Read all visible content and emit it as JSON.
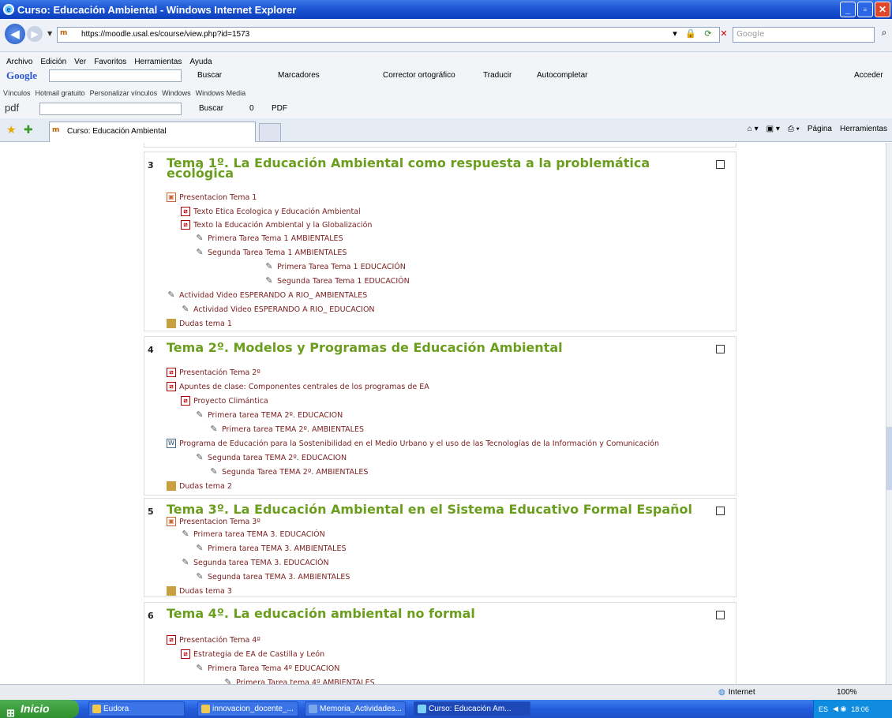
{
  "window": {
    "title": "Curso: Educación Ambiental - Windows Internet Explorer"
  },
  "address": {
    "url": "https://moodle.usal.es/course/view.php?id=1573",
    "search_placeholder": "Google"
  },
  "menu": [
    "Archivo",
    "Edición",
    "Ver",
    "Favoritos",
    "Herramientas",
    "Ayuda"
  ],
  "googlebar": {
    "logo": "Google",
    "buscar": "Buscar",
    "marcadores": "Marcadores",
    "corrector": "Corrector ortográfico",
    "traducir": "Traducir",
    "autocompletar": "Autocompletar",
    "acceder": "Acceder"
  },
  "links": {
    "label": "Vínculos",
    "items": [
      "Hotmail gratuito",
      "Personalizar vínculos",
      "Windows",
      "Windows Media"
    ]
  },
  "pdfbar": {
    "label": "pdf",
    "buscar": "Buscar",
    "count": "0",
    "pdf": "PDF"
  },
  "tab": {
    "title": "Curso: Educación Ambiental"
  },
  "commands": {
    "pagina": "Página",
    "herramientas": "Herramientas"
  },
  "topics": [
    {
      "num": "3",
      "title_line1": "Tema 1º. La Educación Ambiental como respuesta a la problemática",
      "title_line2": "ecológica",
      "items": [
        {
          "label": "Presentacion Tema 1",
          "icon": "ppt-icon"
        },
        {
          "label": "Texto Etica Ecologica y Educación Ambiental",
          "icon": "pdf-icon"
        },
        {
          "label": "Texto la Educación Ambiental y la Globalización",
          "icon": "pdf-icon"
        },
        {
          "label": "Primera Tarea Tema 1 AMBIENTALES",
          "icon": "assignment-icon"
        },
        {
          "label": "Segunda Tarea Tema 1 AMBIENTALES",
          "icon": "assignment-icon"
        },
        {
          "label": "Primera Tarea Tema 1 EDUCACIÓN",
          "icon": "assignment-icon"
        },
        {
          "label": "Segunda Tarea Tema 1 EDUCACIÓN",
          "icon": "assignment-icon"
        },
        {
          "label": "Actividad Video ESPERANDO A RIO_ AMBIENTALES",
          "icon": "assignment-icon"
        },
        {
          "label": "Actividad Video ESPERANDO A RIO_ EDUCACION",
          "icon": "assignment-icon"
        },
        {
          "label": "Dudas tema 1",
          "icon": "forum-icon"
        }
      ]
    },
    {
      "num": "4",
      "title_line1": "Tema 2º. Modelos y Programas de Educación Ambiental",
      "items": [
        {
          "label": "Presentación Tema 2º",
          "icon": "pdf-icon"
        },
        {
          "label": "Apuntes de clase: Componentes centrales de los programas de EA",
          "icon": "pdf-icon"
        },
        {
          "label": "Proyecto Climántica",
          "icon": "pdf-icon"
        },
        {
          "label": "Primera tarea TEMA 2º. EDUCACION",
          "icon": "assignment-icon"
        },
        {
          "label": "Primera tarea TEMA 2º. AMBIENTALES",
          "icon": "assignment-icon"
        },
        {
          "label": "Programa de Educación para la Sostenibilidad en el Medio Urbano y el uso de las Tecnologías de la Información y Comunicación",
          "icon": "doc-icon"
        },
        {
          "label": "Segunda tarea TEMA 2º. EDUCACION",
          "icon": "assignment-icon"
        },
        {
          "label": "Segunda Tarea TEMA 2º. AMBIENTALES",
          "icon": "assignment-icon"
        },
        {
          "label": "Dudas tema 2",
          "icon": "forum-icon"
        }
      ]
    },
    {
      "num": "5",
      "title_line1": "Tema 3º. La Educación Ambiental en el Sistema Educativo Formal Español",
      "items": [
        {
          "label": "Presentacion Tema 3º",
          "icon": "ppt-icon"
        },
        {
          "label": "Primera tarea TEMA 3. EDUCACIÓN",
          "icon": "assignment-icon"
        },
        {
          "label": "Primera tarea TEMA 3. AMBIENTALES",
          "icon": "assignment-icon"
        },
        {
          "label": "Segunda tarea TEMA 3. EDUCACIÓN",
          "icon": "assignment-icon"
        },
        {
          "label": "Segunda tarea TEMA 3. AMBIENTALES",
          "icon": "assignment-icon"
        },
        {
          "label": "Dudas tema 3",
          "icon": "forum-icon"
        }
      ]
    },
    {
      "num": "6",
      "title_line1": "Tema 4º. La educación ambiental no formal",
      "items": [
        {
          "label": "Presentación Tema 4º",
          "icon": "pdf-icon"
        },
        {
          "label": "Estrategia de EA de Castilla y León",
          "icon": "pdf-icon"
        },
        {
          "label": "Primera Tarea Tema 4º EDUCACION",
          "icon": "assignment-icon"
        },
        {
          "label": "Primera Tarea tema 4º AMBIENTALES",
          "icon": "assignment-icon"
        }
      ]
    }
  ],
  "status": {
    "zone": "Internet",
    "zoom": "100%"
  },
  "taskbar": {
    "start": "Inicio",
    "items": [
      "Eudora",
      "innovacion_docente_...",
      "Memoria_Actividades...",
      "Curso: Educación Am..."
    ],
    "lang": "ES",
    "time": "18:06"
  }
}
